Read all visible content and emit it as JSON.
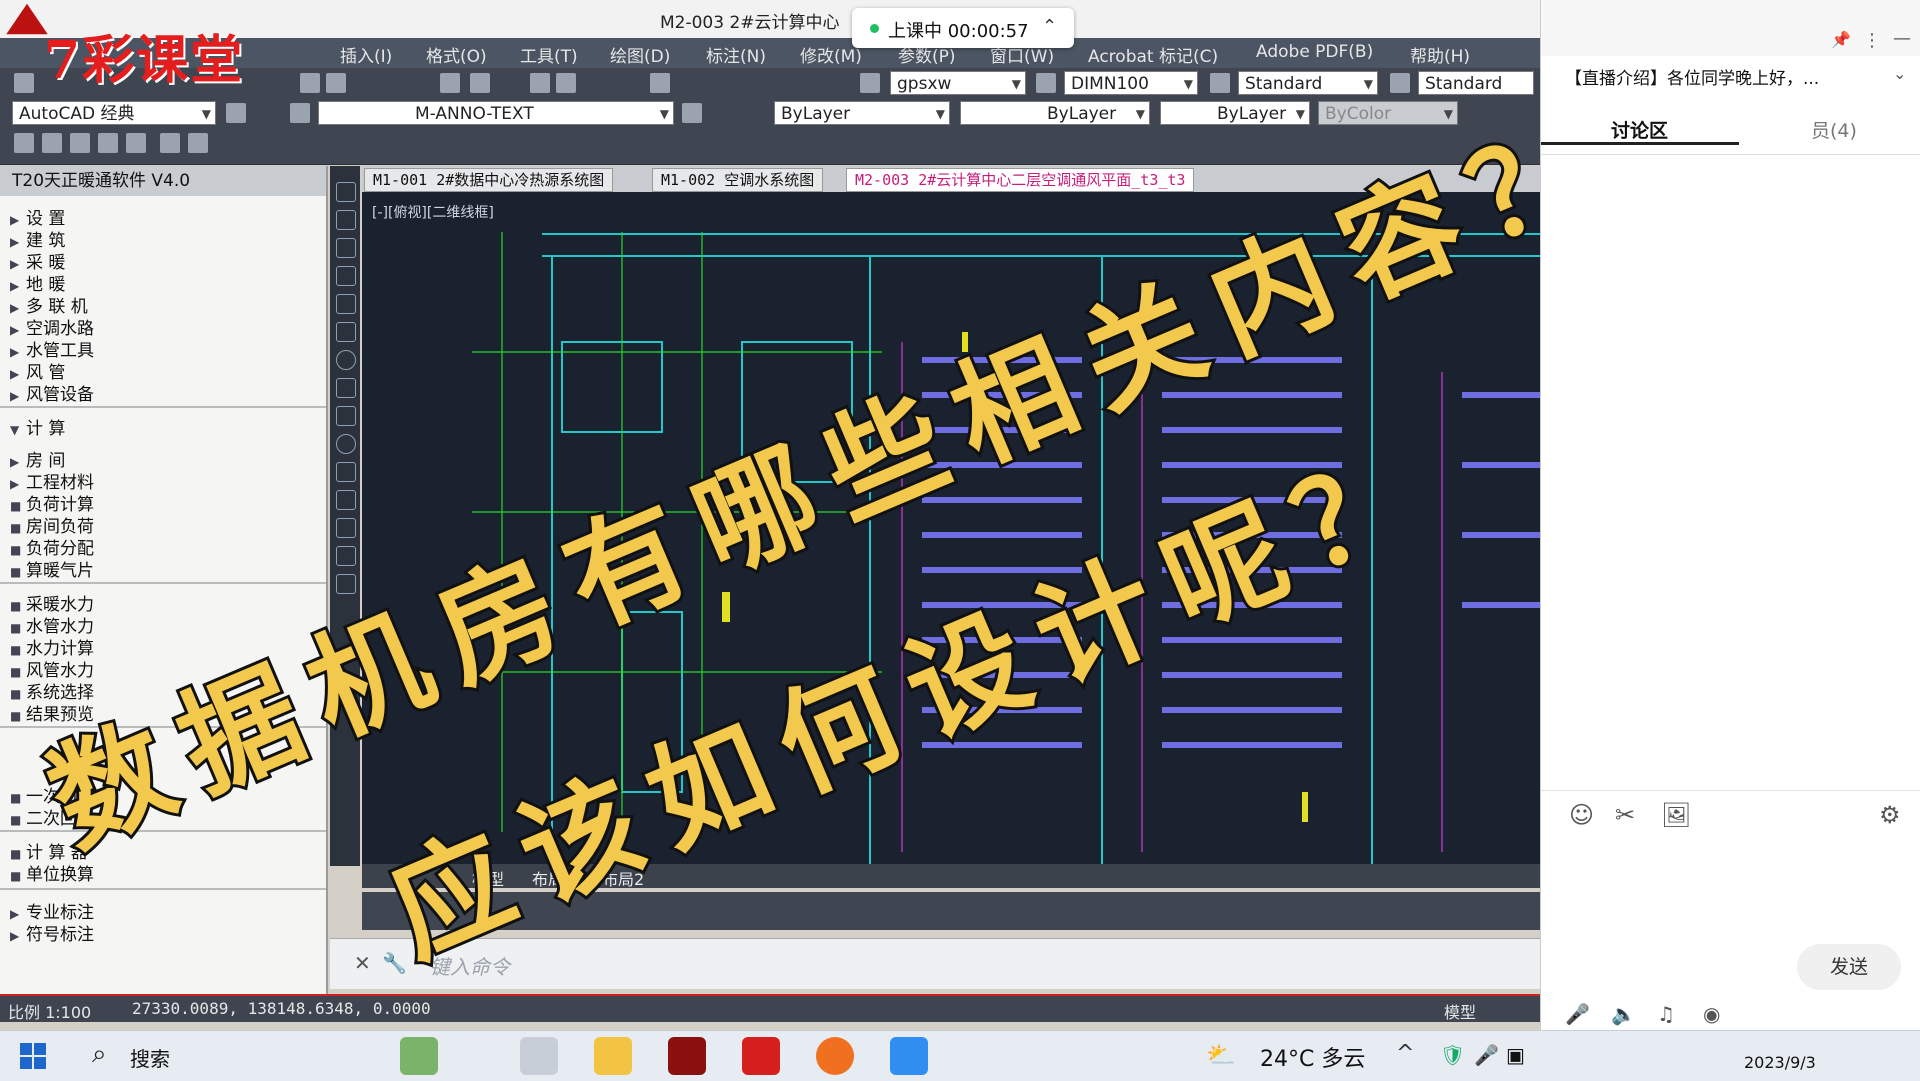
{
  "window": {
    "title": "M2-003 2#云计算中心",
    "brand_watermark": "7彩课堂"
  },
  "menu": [
    "插入(I)",
    "格式(O)",
    "工具(T)",
    "绘图(D)",
    "标注(N)",
    "修改(M)",
    "参数(P)",
    "窗口(W)",
    "Acrobat 标记(C)",
    "Adobe PDF(B)",
    "帮助(H)"
  ],
  "toolbar": {
    "workspace": "AutoCAD 经典",
    "layer": "M-ANNO-TEXT",
    "textstyle": "gpsxw",
    "dimstyle": "DIMN100",
    "tablestyle": "Standard",
    "multileader": "Standard",
    "color": "ByLayer",
    "linetype": "ByLayer",
    "lineweight": "ByLayer",
    "plotstyle": "ByColor"
  },
  "live": {
    "status": "上课中 00:00:57",
    "status_color": "#20c060"
  },
  "sidebar": {
    "title": "T20天正暖通软件 V4.0",
    "items": [
      {
        "label": "设    置",
        "icon": "arrow-right-icon"
      },
      {
        "label": "建    筑",
        "icon": "arrow-right-icon"
      },
      {
        "label": "采    暖",
        "icon": "arrow-right-icon"
      },
      {
        "label": "地    暖",
        "icon": "arrow-right-icon"
      },
      {
        "label": "多 联 机",
        "icon": "arrow-right-icon"
      },
      {
        "label": "空调水路",
        "icon": "arrow-right-icon"
      },
      {
        "label": "水管工具",
        "icon": "arrow-right-icon"
      },
      {
        "label": "风    管",
        "icon": "arrow-right-icon"
      },
      {
        "label": "风管设备",
        "icon": "arrow-right-icon"
      },
      {
        "label": "计    算",
        "icon": "arrow-down-icon"
      },
      {
        "label": "房    间",
        "icon": "arrow-right-icon"
      },
      {
        "label": "工程材料",
        "icon": "arrow-right-icon"
      },
      {
        "label": "负荷计算",
        "icon": "load-calc-icon"
      },
      {
        "label": "房间负荷",
        "icon": "room-load-icon"
      },
      {
        "label": "负荷分配",
        "icon": "load-distribution-icon"
      },
      {
        "label": "算暖气片",
        "icon": "radiator-icon"
      },
      {
        "label": "采暖水力",
        "icon": "heating-hydraulic-icon"
      },
      {
        "label": "水管水力",
        "icon": "pipe-hydraulic-icon"
      },
      {
        "label": "水力计算",
        "icon": "hydraulic-calc-icon"
      },
      {
        "label": "风管水力",
        "icon": "duct-hydraulic-icon"
      },
      {
        "label": "系统选择",
        "icon": "system-select-icon"
      },
      {
        "label": "结果预览",
        "icon": "result-preview-icon"
      },
      {
        "label": "一次回风",
        "icon": "primary-return-icon"
      },
      {
        "label": "二次回风",
        "icon": "secondary-return-icon"
      },
      {
        "label": "计 算 器",
        "icon": "calculator-icon"
      },
      {
        "label": "单位换算",
        "icon": "unit-convert-icon"
      },
      {
        "label": "专业标注",
        "icon": "arrow-right-icon"
      },
      {
        "label": "符号标注",
        "icon": "arrow-right-icon"
      }
    ]
  },
  "doc_tabs": [
    {
      "label": "M1-001 2#数据中心冷热源系统图",
      "active": false
    },
    {
      "label": "M1-002 空调水系统图",
      "active": false
    },
    {
      "label": "M2-003 2#云计算中心二层空调通风平面_t3_t3",
      "active": true
    }
  ],
  "drawing": {
    "view_label": "[-][俯视][二维线框]"
  },
  "layout_tabs": [
    "模型",
    "布局1",
    "布局2"
  ],
  "command": {
    "placeholder": "键入命令"
  },
  "status": {
    "scale": "比例 1:100",
    "coords": "27330.0089, 138148.6348, 0.0000",
    "model": "模型"
  },
  "panel": {
    "announcement": "【直播介绍】各位同学晚上好，...",
    "tab_discussion": "讨论区",
    "tab_members": "员(4)",
    "send_label": "发送"
  },
  "overlay": {
    "line1": "数据机房有哪些相关内容？",
    "line2": "应该如何设计呢？",
    "color": "#f2c94c"
  },
  "taskbar": {
    "search": "搜索",
    "weather": "24°C  多云",
    "date": "2023/9/3"
  }
}
